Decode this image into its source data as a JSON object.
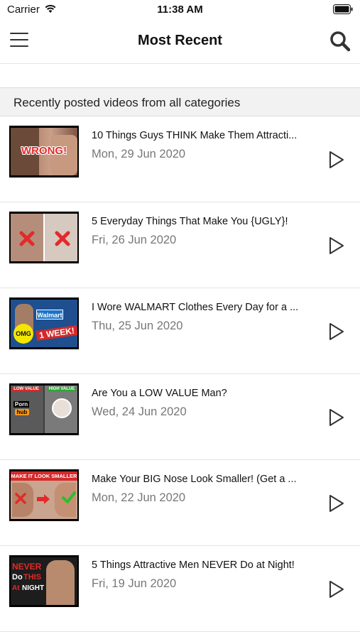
{
  "status_bar": {
    "carrier": "Carrier",
    "time": "11:38 AM"
  },
  "nav": {
    "title": "Most Recent"
  },
  "section": {
    "header": "Recently posted videos from all categories"
  },
  "videos": [
    {
      "title": "10 Things Guys THINK Make Them Attracti...",
      "date": "Mon, 29 Jun 2020",
      "thumb_text": [
        "WRONG!"
      ]
    },
    {
      "title": "5 Everyday Things That Make You {UGLY}!",
      "date": "Fri, 26 Jun 2020",
      "thumb_text": []
    },
    {
      "title": "I Wore WALMART Clothes Every Day for a ...",
      "date": "Thu, 25 Jun 2020",
      "thumb_text": [
        "Walmart",
        "OMG",
        "1 WEEK!"
      ]
    },
    {
      "title": "Are You a LOW VALUE Man?",
      "date": "Wed, 24 Jun 2020",
      "thumb_text": [
        "LOW VALUE",
        "HIGH VALUE",
        "Porn",
        "hub"
      ]
    },
    {
      "title": "Make Your BIG Nose Look Smaller! (Get a ...",
      "date": "Mon, 22 Jun 2020",
      "thumb_text": [
        "MAKE IT LOOK SMALLER"
      ]
    },
    {
      "title": "5 Things Attractive Men NEVER Do at Night!",
      "date": "Fri, 19 Jun 2020",
      "thumb_text": [
        "NEVER",
        "Do",
        "THIS",
        "At",
        "NIGHT"
      ]
    }
  ],
  "colors": {
    "accent_red": "#e32a2a",
    "play_icon": "#333333",
    "date_gray": "#777777"
  },
  "icons": {
    "menu": "hamburger-menu-icon",
    "search": "search-icon",
    "play": "play-icon"
  }
}
